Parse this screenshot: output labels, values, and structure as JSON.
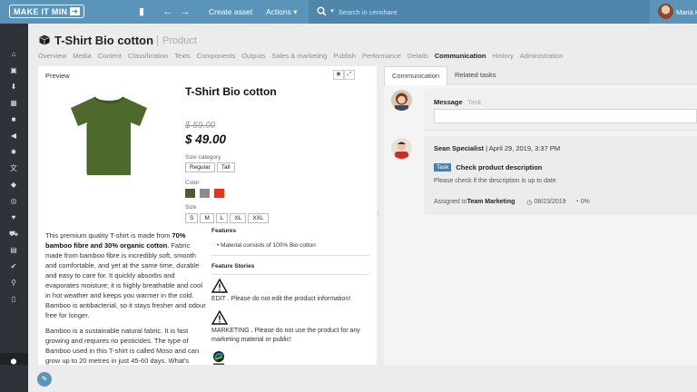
{
  "topbar": {
    "logo_text": "MAKE IT MIN",
    "logo_arrow_icon": "arrow-right-icon",
    "create_asset": "Create asset",
    "actions": "Actions",
    "actions_caret": "▾",
    "search_placeholder": "Search in censhare",
    "user_name": "Maria K"
  },
  "title": {
    "name": "T-Shirt Bio cotton",
    "type": "Product"
  },
  "nav_tabs": [
    "Overview",
    "Media",
    "Content",
    "Classification",
    "Texts",
    "Components",
    "Outputs",
    "Sales & marketing",
    "Publish",
    "Performance",
    "Details",
    "Communication",
    "History",
    "Administration"
  ],
  "nav_active": "Communication",
  "preview": {
    "label": "Preview",
    "product_title": "T-Shirt Bio cotton",
    "old_price": "$ 59.00",
    "new_price": "$ 49.00",
    "size_category_label": "Size category",
    "size_categories": [
      "Regular",
      "Tall"
    ],
    "color_label": "Color",
    "colors": [
      "#4a5e2e",
      "#8c8c8c",
      "#e8321e"
    ],
    "size_label": "Size",
    "sizes": [
      "S",
      "M",
      "L",
      "XL",
      "XXL"
    ],
    "desc_p1_a": "This premium quality T-shirt is made from ",
    "desc_p1_b": "70% bamboo fibre and 30% organic cotton",
    "desc_p1_c": ". Fabric made from bamboo fibre is incredibly soft, smooth and comfortable, and yet at the same time, durable and easy to care for. It quickly absorbs and evaporates moisture; it is highly breathable and cool in hot weather and keeps you warmer in the cold. Bamboo is antibacterial, so it stays fresher and odour free for longer.",
    "desc_p2": "Bamboo is a sustainable natural fabric. It is fast growing and requires no pesticides. The type of Bamboo used in this T-shirt is called Moso and can grow up to 20 metres in just 45-60 days. What's more,",
    "features_label": "Features",
    "feature_item": "Material consists of 100% Bio cotton",
    "feature_stories_label": "Feature Stories",
    "story1": "EDIT . Please do not edit the product information!",
    "story2": "MARKETING . Please do not use the product for any marketing material or public!"
  },
  "communication": {
    "tab_communication": "Communication",
    "tab_related": "Related tasks",
    "message_label": "Message",
    "task_label": "Task",
    "post_author": "Sean Specialist",
    "post_date": " | April 29, 2019, 3:37 PM",
    "task_badge": "Task",
    "task_title": "Check product description",
    "task_text": "Please check if the description is up to date.",
    "assigned_prefix": "Assigned to ",
    "assigned_to": "Team Marketing",
    "due_date": "08/23/2019",
    "progress": "0%"
  }
}
